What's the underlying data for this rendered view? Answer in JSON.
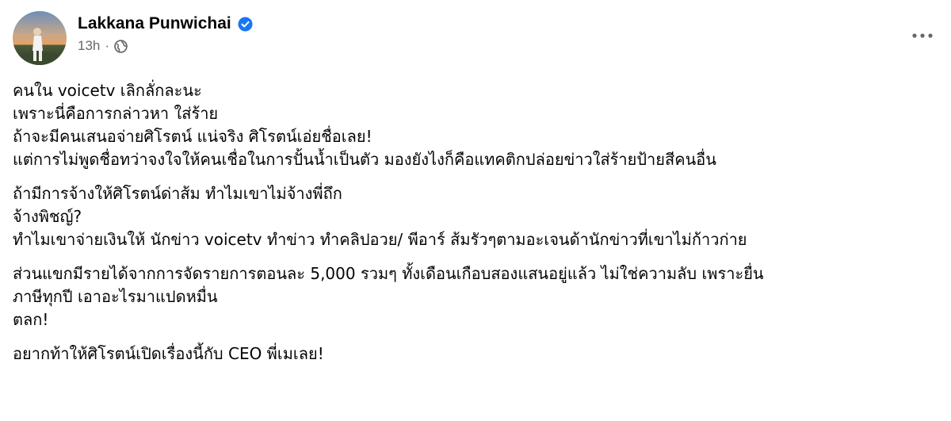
{
  "author": {
    "name": "Lakkana Punwichai",
    "verified": true,
    "time": "13h",
    "separator": "·",
    "privacy_icon": "globe-icon"
  },
  "menu": {
    "icon": "more-horizontal-icon"
  },
  "colors": {
    "verified_blue": "#1877f2",
    "secondary_text": "#65676b",
    "primary_text": "#050505"
  },
  "post": {
    "paragraphs": [
      {
        "lines": [
          "คนใน voicetv เลิกลั่กละนะ",
          "เพราะนี่คือการกล่าวหา ใส่ร้าย",
          "ถ้าจะมีคนเสนอจ่ายศิโรตน์ แน่จริง ศิโรตน์เอ่ยชื่อเลย!",
          "แต่การไม่พูดชื่อทว่าจงใจให้คนเชื่อในการปั้นน้ำเป็นตัว มองยังไงก็คือแทคติกปล่อยข่าวใส่ร้ายป้ายสีคนอื่น"
        ]
      },
      {
        "lines": [
          "ถ้ามีการจ้างให้ศิโรตน์ด่าส้ม ทำไมเขาไม่จ้างพี่ถึก",
          "จ้างพิชญ์?",
          "ทำไมเขาจ่ายเงินให้ นักข่าว voicetv ทำข่าว ทำคลิปอวย/ พีอาร์ ส้มรัวๆตามอะเจนด้านักข่าวที่เขาไม่ก้าวก่าย"
        ]
      },
      {
        "lines": [
          "ส่วนแขกมีรายได้จากการจัดรายการตอนละ 5,000 รวมๆ ทั้งเดือนเกือบสองแสนอยู่แล้ว ไม่ใช่ความลับ เพราะยื่น",
          "ภาษีทุกปี เอาอะไรมาแปดหมื่น",
          "ตลก!"
        ]
      },
      {
        "lines": [
          "อยากท้าให้ศิโรตน์เปิดเรื่องนี้กับ CEO พี่เมเลย!"
        ]
      }
    ]
  }
}
